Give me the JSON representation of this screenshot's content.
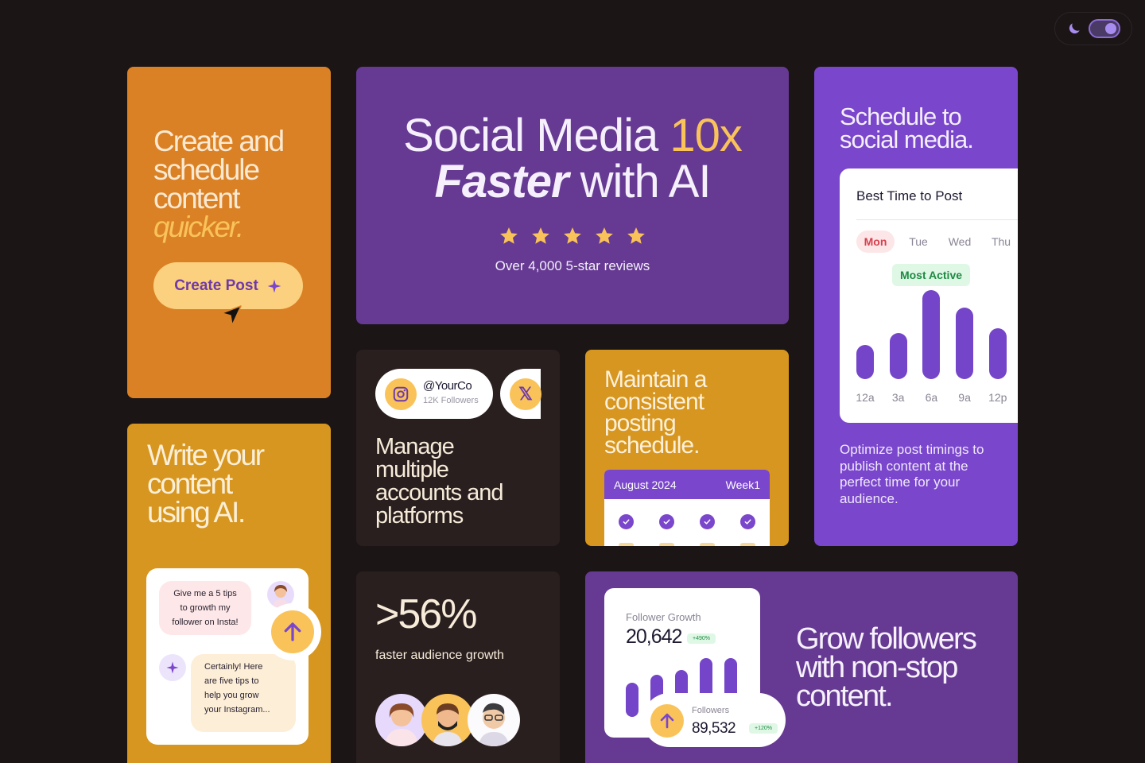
{
  "theme_toggle": {
    "icon": "moon-icon",
    "state": "dark"
  },
  "colors": {
    "background": "#1b1516",
    "orange": "#da8125",
    "purple": "#663a93",
    "violet": "#7a46cc",
    "mustard": "#d6961f",
    "dark_card": "#2a1f1f",
    "accent_yellow": "#f9c35a"
  },
  "create_card": {
    "lines": [
      "Create and",
      "schedule",
      "content"
    ],
    "highlight": "quicker.",
    "button_label": "Create Post"
  },
  "hero": {
    "title_part1": "Social Media ",
    "title_highlight": "10x",
    "title_italic": "Faster",
    "title_part2": " with AI",
    "rating": 5,
    "reviews": "Over 4,000 5-star reviews"
  },
  "schedule_card": {
    "lines": [
      "Schedule to",
      "social media."
    ],
    "widget_title": "Best Time to Post",
    "days": [
      "Mon",
      "Tue",
      "Wed",
      "Thu"
    ],
    "active_day": "Mon",
    "badge": "Most Active",
    "time_labels": [
      "12a",
      "3a",
      "6a",
      "9a",
      "12p"
    ],
    "activity": [
      0.38,
      0.52,
      1.0,
      0.8,
      0.57
    ],
    "description": "Optimize post timings to publish content at the perfect time for your audience."
  },
  "accounts_card": {
    "handle": "@YourCo",
    "followers": "12K Followers",
    "x_glyph": "𝕏",
    "lines": [
      "Manage",
      "multiple",
      "accounts and",
      "platforms"
    ]
  },
  "consistency_card": {
    "lines": [
      "Maintain a",
      "consistent",
      "posting",
      "schedule."
    ],
    "calendar_month": "August 2024",
    "calendar_week": "Week1",
    "checked_days": 4
  },
  "ai_card": {
    "lines": [
      "Write your",
      "content",
      "using AI."
    ],
    "user_message_lines": [
      "Give me a 5 tips",
      "to growth my",
      "follower on Insta!"
    ],
    "ai_message_lines": [
      "Certainly! Here",
      "are five tips to",
      "help you grow",
      "your Instagram..."
    ]
  },
  "stat_card": {
    "value": ">56%",
    "label": "faster audience growth"
  },
  "growth_card": {
    "widget_label": "Follower Growth",
    "widget_value": "20,642",
    "widget_badge": "+490%",
    "growth_bars": [
      0.55,
      0.68,
      0.75,
      0.95,
      0.95
    ],
    "followers_label": "Followers",
    "followers_value": "89,532",
    "followers_badge": "+120%",
    "lines": [
      "Grow followers",
      "with non-stop",
      "content."
    ]
  }
}
